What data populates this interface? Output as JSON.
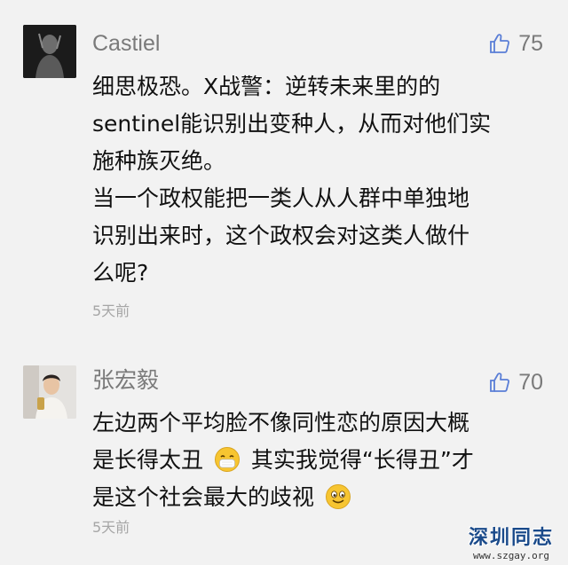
{
  "comments": [
    {
      "username": "Castiel",
      "likes": "75",
      "lines": [
        "细思极恐。X战警：逆转未来里的的",
        "sentinel能识别出变种人，从而对他们实",
        "施种族灭绝。",
        "当一个政权能把一类人从人群中单独地",
        "识别出来时，这个政权会对这类人做什",
        "么呢?"
      ],
      "time": "5天前",
      "avatar_icon": "dark-figure-avatar"
    },
    {
      "username": "张宏毅",
      "likes": "70",
      "line1": "左边两个平均脸不像同性恋的原因大概",
      "line2_a": "是长得太丑",
      "line2_b": "其实我觉得“长得丑”才",
      "line3": "是这个社会最大的歧视",
      "time": "5天前",
      "emoji_1": "mask-emoji",
      "emoji_2": "smile-emoji",
      "avatar_icon": "person-photo-avatar"
    }
  ],
  "watermark": {
    "title": "深圳同志",
    "url": "www.szgay.org"
  },
  "colors": {
    "background": "#f2f2f2",
    "meta_text": "#7a7a7a",
    "body_text": "#111111",
    "watermark_blue": "#1a4a8a"
  }
}
